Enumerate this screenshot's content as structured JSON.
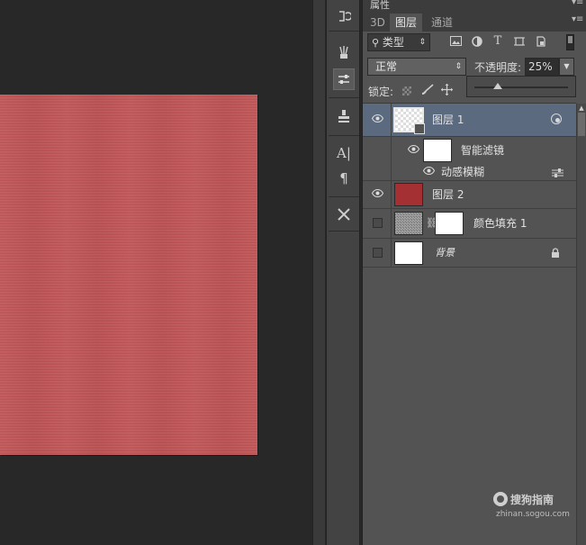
{
  "panel": {
    "header_label": "属性",
    "tabs": [
      {
        "label": "3D"
      },
      {
        "label": "图层"
      },
      {
        "label": "通道"
      }
    ],
    "filter": {
      "kind_label": "类型",
      "filter_icons": [
        "image-icon",
        "circle-half-icon",
        "text-T-icon",
        "crop-square-icon",
        "smart-object-icon"
      ]
    },
    "blend": {
      "mode": "正常",
      "opacity_label": "不透明度:",
      "opacity_value": "25%",
      "opacity_fraction": 0.25
    },
    "lock": {
      "label": "锁定:",
      "lock_icons": [
        "checker-icon",
        "brush-icon",
        "move-icon"
      ]
    },
    "layers": [
      {
        "name": "图层 1",
        "selected": true,
        "visible": true,
        "thumb": "transparent"
      },
      {
        "name": "智能滤镜",
        "sub": true,
        "visible": true,
        "thumb": "white"
      },
      {
        "name": "动感模糊",
        "sub": true,
        "visible": true
      },
      {
        "name": "图层 2",
        "visible": true,
        "thumb_color": "#a53033"
      },
      {
        "name": "颜色填充 1",
        "visible": false,
        "thumb": "noise+white"
      },
      {
        "name": "背景",
        "visible": false,
        "locked": true,
        "thumb": "white"
      }
    ]
  },
  "canvas": {
    "doc_color": "#c05556"
  },
  "tools": [
    "history-icon",
    "brushes-icon",
    "adjust-panel-icon",
    "clone-stamp-icon",
    "character-icon",
    "paragraph-icon",
    "tools-icon"
  ],
  "watermark": {
    "brand": "搜狗指南",
    "url": "zhinan.sogou.com"
  }
}
